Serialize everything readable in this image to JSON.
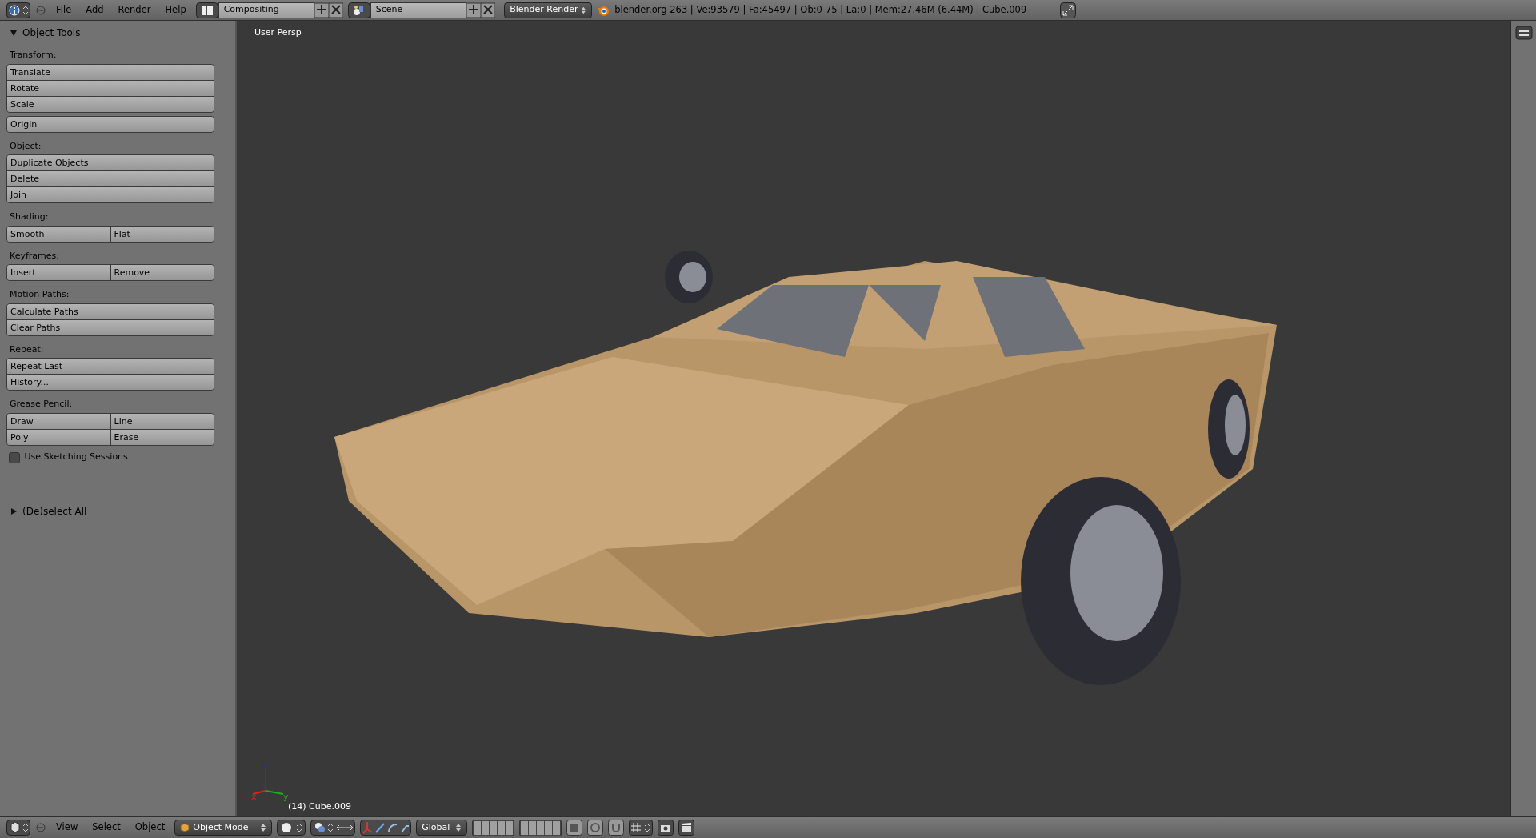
{
  "top_bar": {
    "menus": [
      "File",
      "Add",
      "Render",
      "Help"
    ],
    "screen_layout": "Compositing",
    "scene": "Scene",
    "render_engine": "Blender Render",
    "stats": "blender.org 263 | Ve:93579 | Fa:45497 | Ob:0-75 | La:0 | Mem:27.46M (6.44M) | Cube.009"
  },
  "tool_panel": {
    "title": "Object Tools",
    "expanded": true,
    "sections": [
      {
        "label": "Transform:",
        "groups": [
          [
            [
              "Translate"
            ],
            [
              "Rotate"
            ],
            [
              "Scale"
            ]
          ],
          [
            [
              "Origin"
            ]
          ]
        ]
      },
      {
        "label": "Object:",
        "groups": [
          [
            [
              "Duplicate Objects"
            ],
            [
              "Delete"
            ],
            [
              "Join"
            ]
          ]
        ]
      },
      {
        "label": "Shading:",
        "groups": [
          [
            [
              "Smooth",
              "Flat"
            ]
          ]
        ]
      },
      {
        "label": "Keyframes:",
        "groups": [
          [
            [
              "Insert",
              "Remove"
            ]
          ]
        ]
      },
      {
        "label": "Motion Paths:",
        "groups": [
          [
            [
              "Calculate Paths"
            ],
            [
              "Clear Paths"
            ]
          ]
        ]
      },
      {
        "label": "Repeat:",
        "groups": [
          [
            [
              "Repeat Last"
            ],
            [
              "History..."
            ]
          ]
        ]
      },
      {
        "label": "Grease Pencil:",
        "groups": [
          [
            [
              "Draw",
              "Line"
            ],
            [
              "Poly",
              "Erase"
            ]
          ]
        ]
      }
    ],
    "checkbox": {
      "label": "Use Sketching Sessions",
      "checked": false
    }
  },
  "second_panel": {
    "title": "(De)select All",
    "expanded": false
  },
  "viewport": {
    "view_label": "User Persp",
    "object_label": "(14) Cube.009",
    "axes": [
      "x",
      "y",
      "z"
    ]
  },
  "bottom_bar": {
    "menus": [
      "View",
      "Select",
      "Object"
    ],
    "mode": "Object Mode",
    "orientation": "Global"
  }
}
